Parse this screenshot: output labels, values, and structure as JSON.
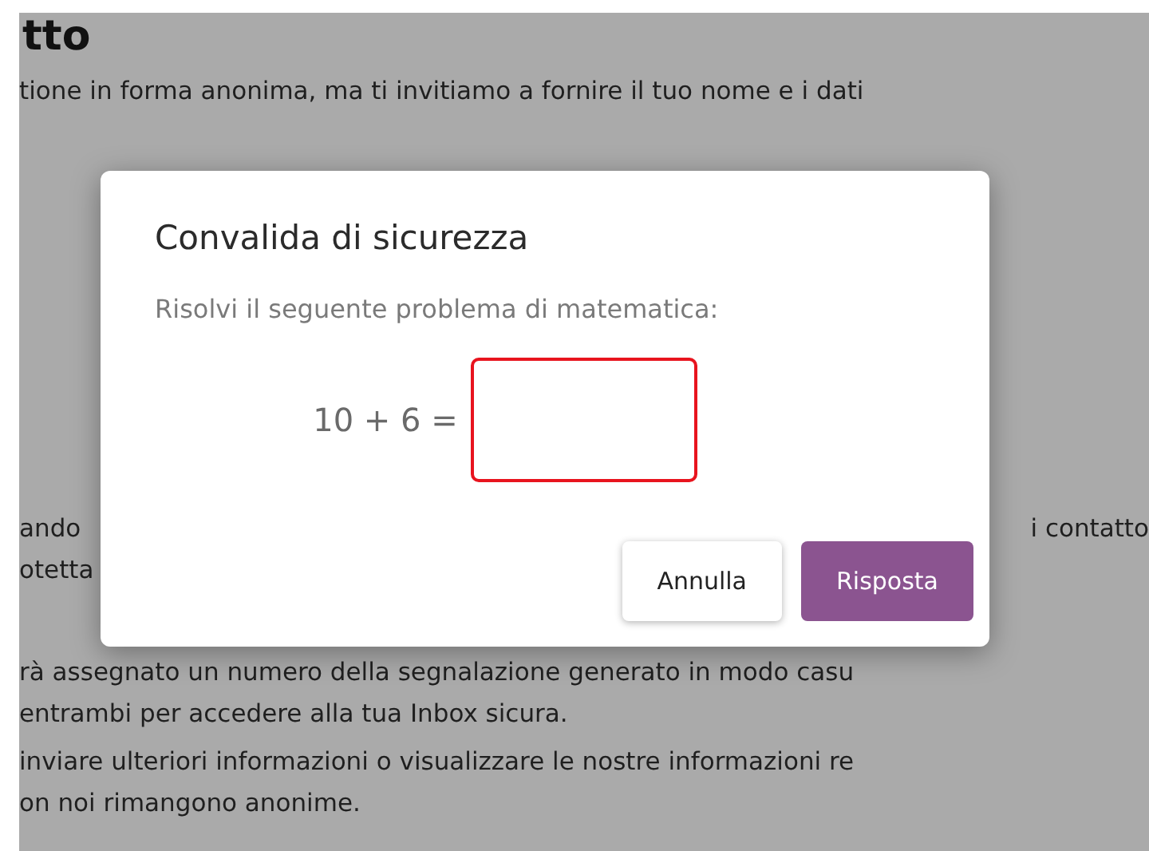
{
  "page": {
    "heading": "tto",
    "paragraphs": [
      {
        "lines": [
          {
            "left": "tione in forma anonima, ma ti invitiamo a fornire il tuo nome e i dati"
          }
        ]
      },
      {
        "lines": [
          {
            "left": "ando",
            "right": "i contatto"
          },
          {
            "left": "otetta"
          }
        ]
      },
      {
        "lines": [
          {
            "left": "rà assegnato un numero della segnalazione generato in modo casu"
          },
          {
            "left": "entrambi per accedere alla tua Inbox sicura."
          }
        ]
      },
      {
        "lines": [
          {
            "left": "inviare ulteriori informazioni o visualizzare le nostre informazioni re"
          },
          {
            "left": "on noi rimangono anonime."
          }
        ]
      }
    ]
  },
  "dialog": {
    "title": "Convalida di sicurezza",
    "prompt": "Risolvi il seguente problema di matematica:",
    "equation": "10 + 6 =",
    "answer": {
      "invalid": true
    },
    "buttons": [
      {
        "label": "Annulla",
        "kind": "secondary"
      },
      {
        "label": "Risposta",
        "kind": "primary"
      }
    ]
  }
}
